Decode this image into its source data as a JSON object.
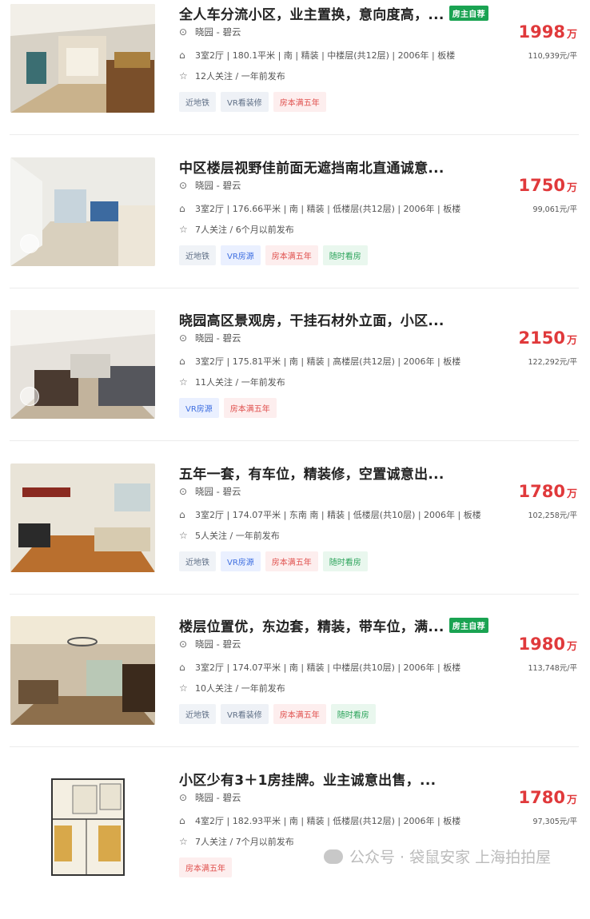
{
  "listings": [
    {
      "title": "全人车分流小区，业主置换，意向度高，...",
      "owner_badge": "房主自荐",
      "location": "晓园 - 碧云",
      "info": "3室2厅 | 180.1平米 | 南 | 精装 | 中楼层(共12层) | 2006年 | 板楼",
      "follow": "12人关注 / 一年前发布",
      "tags": [
        "近地铁",
        "VR看装修",
        "房本满五年"
      ],
      "price": "1998",
      "price_unit": "万",
      "unit_price": "110,939元/平"
    },
    {
      "title": "中区楼层视野佳前面无遮挡南北直通诚意...",
      "owner_badge": "",
      "location": "晓园 - 碧云",
      "info": "3室2厅 | 176.66平米 | 南 | 精装 | 低楼层(共12层) | 2006年 | 板楼",
      "follow": "7人关注 / 6个月以前发布",
      "tags": [
        "近地铁",
        "VR房源",
        "房本满五年",
        "随时看房"
      ],
      "price": "1750",
      "price_unit": "万",
      "unit_price": "99,061元/平"
    },
    {
      "title": "晓园高区景观房，干挂石材外立面，小区...",
      "owner_badge": "",
      "location": "晓园 - 碧云",
      "info": "3室2厅 | 175.81平米 | 南 | 精装 | 高楼层(共12层) | 2006年 | 板楼",
      "follow": "11人关注 / 一年前发布",
      "tags": [
        "VR房源",
        "房本满五年"
      ],
      "price": "2150",
      "price_unit": "万",
      "unit_price": "122,292元/平"
    },
    {
      "title": "五年一套，有车位，精装修，空置诚意出...",
      "owner_badge": "",
      "location": "晓园 - 碧云",
      "info": "3室2厅 | 174.07平米 | 东南 南 | 精装 | 低楼层(共10层) | 2006年 | 板楼",
      "follow": "5人关注 / 一年前发布",
      "tags": [
        "近地铁",
        "VR房源",
        "房本满五年",
        "随时看房"
      ],
      "price": "1780",
      "price_unit": "万",
      "unit_price": "102,258元/平"
    },
    {
      "title": "楼层位置优，东边套，精装，带车位，满...",
      "owner_badge": "房主自荐",
      "location": "晓园 - 碧云",
      "info": "3室2厅 | 174.07平米 | 南 | 精装 | 中楼层(共10层) | 2006年 | 板楼",
      "follow": "10人关注 / 一年前发布",
      "tags": [
        "近地铁",
        "VR看装修",
        "房本满五年",
        "随时看房"
      ],
      "price": "1980",
      "price_unit": "万",
      "unit_price": "113,748元/平"
    },
    {
      "title": "小区少有3＋1房挂牌。业主诚意出售，...",
      "owner_badge": "",
      "location": "晓园 - 碧云",
      "info": "4室2厅 | 182.93平米 | 南 | 精装 | 低楼层(共12层) | 2006年 | 板楼",
      "follow": "7人关注 / 7个月以前发布",
      "tags": [
        "房本满五年"
      ],
      "price": "1780",
      "price_unit": "万",
      "unit_price": "97,305元/平"
    }
  ],
  "watermark": "公众号 · 袋鼠安家 上海拍拍屋",
  "icons": {
    "location": "location-pin-icon",
    "house": "house-icon",
    "star": "star-icon"
  },
  "colors": {
    "price": "#e0393b",
    "owner_badge": "#1aa352",
    "tag_red": "#e0504d",
    "tag_blue": "#3f6fe0",
    "tag_green": "#2ba35a"
  }
}
